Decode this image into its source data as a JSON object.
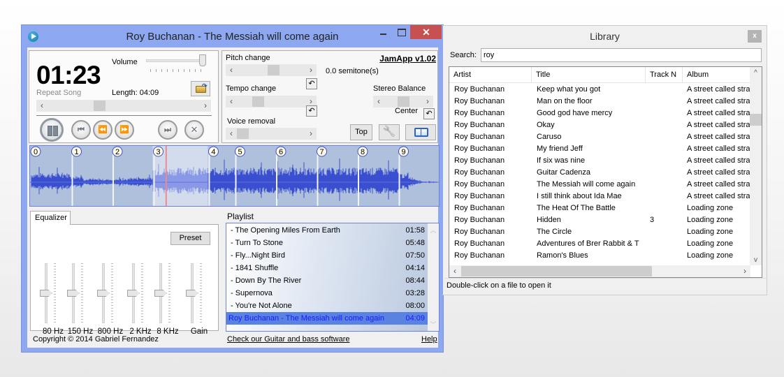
{
  "main_window": {
    "title": "Roy Buchanan - The Messiah will come again",
    "controls": {
      "minimize": "minimize",
      "maximize": "maximize",
      "close": "✕"
    }
  },
  "transport": {
    "time": "01:23",
    "repeat_mode": "Repeat Song",
    "volume_label": "Volume",
    "volume_percent": 95,
    "length_label": "Length: 04:09",
    "position_percent": 33,
    "buttons": {
      "prev": "⏮",
      "rewind": "⏪",
      "forward": "⏩",
      "next": "⏭",
      "stop": "✕"
    }
  },
  "effects": {
    "app_title": "JamApp v1.02",
    "pitch_label": "Pitch change",
    "pitch_value": "0.0 semitone(s)",
    "tempo_label": "Tempo change",
    "voice_label": "Voice removal",
    "stereo_label": "Stereo Balance",
    "stereo_value": "Center",
    "reset_glyph": "↶",
    "top_button": "Top",
    "settings_glyph": "🔧"
  },
  "waveform": {
    "markers": [
      "0",
      "1",
      "2",
      "3",
      "4",
      "5",
      "6",
      "7",
      "8",
      "9"
    ],
    "marker_positions_fraction": [
      0.0,
      0.1,
      0.2,
      0.3,
      0.435,
      0.5,
      0.6,
      0.7,
      0.8,
      0.9
    ],
    "loop_region_fraction": [
      0.3,
      0.435
    ],
    "playhead_fraction": 0.333,
    "colors": {
      "wave": "#3a4fd0",
      "wave_loop": "#8a98e8",
      "background": "#afc0dc",
      "loop_bg": "#d3dcec",
      "playhead": "#f08a8a"
    }
  },
  "equalizer": {
    "tab_label": "Equalizer",
    "preset_label": "Preset",
    "bands": [
      {
        "label": "80 Hz",
        "level": 0.5
      },
      {
        "label": "150 Hz",
        "level": 0.5
      },
      {
        "label": "800 Hz",
        "level": 0.5
      },
      {
        "label": "2 KHz",
        "level": 0.5
      },
      {
        "label": "8 KHz",
        "level": 0.5
      },
      {
        "label": "Gain",
        "level": 0.5
      }
    ]
  },
  "playlist": {
    "label": "Playlist",
    "items": [
      {
        "title": "- The Opening  Miles From Earth",
        "duration": "01:58",
        "selected": false
      },
      {
        "title": "- Turn To Stone",
        "duration": "05:48",
        "selected": false
      },
      {
        "title": "- Fly...Night Bird",
        "duration": "07:50",
        "selected": false
      },
      {
        "title": "- 1841 Shuffle",
        "duration": "04:14",
        "selected": false
      },
      {
        "title": "- Down By The River",
        "duration": "08:44",
        "selected": false
      },
      {
        "title": "- Supernova",
        "duration": "03:28",
        "selected": false
      },
      {
        "title": "- You're Not Alone",
        "duration": "08:00",
        "selected": false
      },
      {
        "title": "Roy Buchanan - The Messiah will come again",
        "duration": "04:09",
        "selected": true
      }
    ]
  },
  "footer": {
    "copyright": "Copyright © 2014 Gabriel Fernandez",
    "guitar_link": "Check our Guitar and bass software",
    "help_link": "Help"
  },
  "library": {
    "title": "Library",
    "close": "x",
    "search_label": "Search:",
    "search_value": "roy",
    "columns": [
      "Artist",
      "Title",
      "Track N",
      "Album"
    ],
    "rows": [
      [
        "Roy Buchanan",
        "Keep what you got",
        "",
        "A street called stra"
      ],
      [
        "Roy Buchanan",
        "Man on the floor",
        "",
        "A street called stra"
      ],
      [
        "Roy Buchanan",
        "Good god have mercy",
        "",
        "A street called stra"
      ],
      [
        "Roy Buchanan",
        "Okay",
        "",
        "A street called stra"
      ],
      [
        "Roy Buchanan",
        "Caruso",
        "",
        "A street called stra"
      ],
      [
        "Roy Buchanan",
        "My friend Jeff",
        "",
        "A street called stra"
      ],
      [
        "Roy Buchanan",
        "If six was nine",
        "",
        "A street called stra"
      ],
      [
        "Roy Buchanan",
        "Guitar Cadenza",
        "",
        "A street called stra"
      ],
      [
        "Roy Buchanan",
        "The Messiah will come again",
        "",
        "A street called stra"
      ],
      [
        "Roy Buchanan",
        "I still think about Ida Mae",
        "",
        "A street called stra"
      ],
      [
        "Roy Buchanan",
        "The Heat Of The Battle",
        "",
        "Loading zone"
      ],
      [
        "Roy Buchanan",
        "Hidden",
        "3",
        "Loading zone"
      ],
      [
        "Roy Buchanan",
        "The Circle",
        "",
        "Loading zone"
      ],
      [
        "Roy Buchanan",
        "Adventures of Brer Rabbit & T",
        "",
        "Loading zone"
      ],
      [
        "Roy Buchanan",
        "Ramon's Blues",
        "",
        "Loading zone"
      ]
    ],
    "status": "Double-click on a file to open it"
  }
}
